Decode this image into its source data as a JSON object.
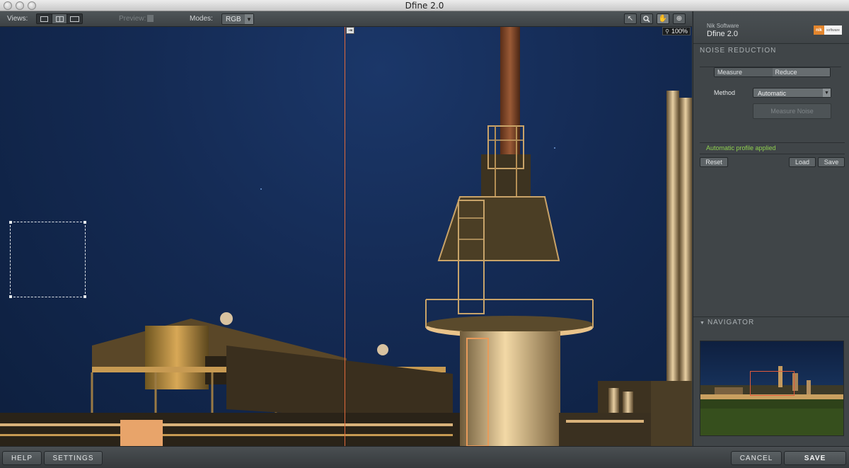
{
  "window": {
    "title": "Dfine 2.0"
  },
  "toolbar": {
    "views_label": "Views:",
    "preview_label": "Preview:",
    "modes_label": "Modes:",
    "mode_value": "RGB",
    "tools": [
      "arrow-tool-icon",
      "zoom-tool-icon",
      "hand-tool-icon",
      "pin-tool-icon"
    ]
  },
  "canvas": {
    "zoom": "100%"
  },
  "panel": {
    "company": "Nik Software",
    "product": "Dfine 2.0",
    "logo_text": "nik",
    "logo_sub": "software",
    "noise_reduction_header": "NOISE REDUCTION",
    "tab_measure": "Measure",
    "tab_reduce": "Reduce",
    "method_label": "Method",
    "method_value": "Automatic",
    "measure_noise_button": "Measure Noise",
    "status": "Automatic profile applied",
    "reset_button": "Reset",
    "load_button": "Load",
    "save_button": "Save",
    "navigator_header": "NAVIGATOR"
  },
  "bottom": {
    "help": "HELP",
    "settings": "SETTINGS",
    "cancel": "CANCEL",
    "save": "SAVE"
  },
  "colors": {
    "accent_split_line": "#e06a3c",
    "status_green": "#8fd14f",
    "panel_bg": "#404548",
    "sky": "#142a53"
  }
}
